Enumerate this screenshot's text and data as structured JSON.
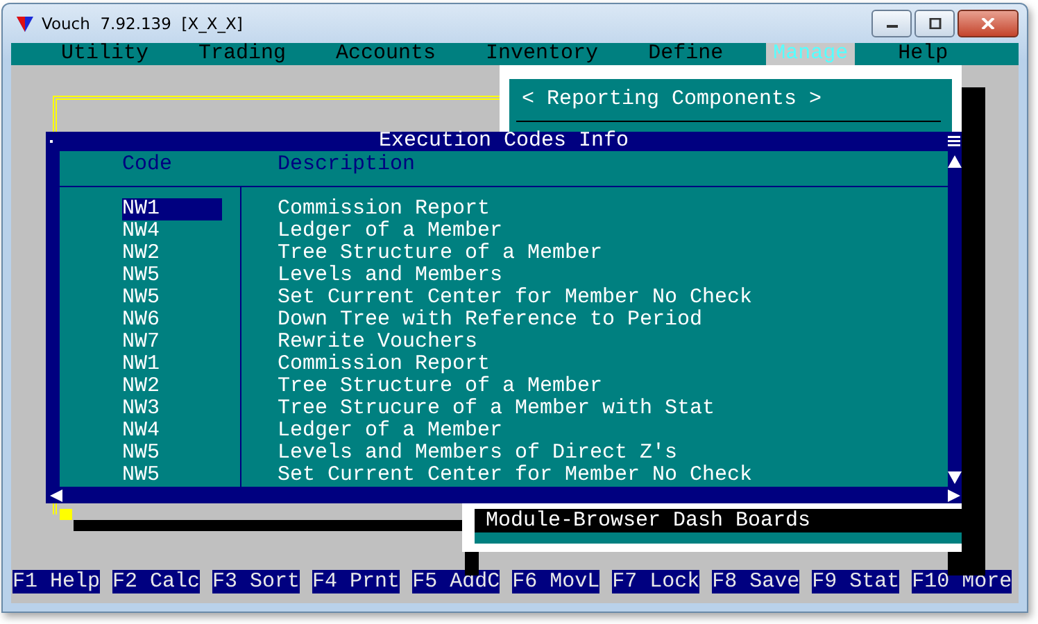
{
  "window": {
    "title": "Vouch  7.92.139  [X_X_X]"
  },
  "menu": [
    {
      "label": "Utility",
      "selected": false
    },
    {
      "label": "Trading",
      "selected": false
    },
    {
      "label": "Accounts",
      "selected": false
    },
    {
      "label": "Inventory",
      "selected": false
    },
    {
      "label": "Define",
      "selected": false
    },
    {
      "label": "Manage",
      "selected": true
    },
    {
      "label": "Help",
      "selected": false
    }
  ],
  "dropdown": {
    "items": [
      {
        "label": "< Reporting Components >",
        "selected": false
      },
      {
        "label": "Module-Browser Dash Boards",
        "selected": true
      }
    ]
  },
  "dialog": {
    "title": "Execution Codes Info",
    "columns": [
      "Code",
      "Description"
    ],
    "rows": [
      {
        "code": "NW1",
        "description": "Commission Report",
        "selected": true
      },
      {
        "code": "NW4",
        "description": "Ledger of a Member",
        "selected": false
      },
      {
        "code": "NW2",
        "description": "Tree Structure of a Member",
        "selected": false
      },
      {
        "code": "NW5",
        "description": "Levels and Members",
        "selected": false
      },
      {
        "code": "NW5",
        "description": "Set Current Center for Member No Check",
        "selected": false
      },
      {
        "code": "NW6",
        "description": "Down Tree with Reference to Period",
        "selected": false
      },
      {
        "code": "NW7",
        "description": "Rewrite Vouchers",
        "selected": false
      },
      {
        "code": "NW1",
        "description": "Commission Report",
        "selected": false
      },
      {
        "code": "NW2",
        "description": "Tree Structure of a Member",
        "selected": false
      },
      {
        "code": "NW3",
        "description": "Tree Strucure of a Member with Stat",
        "selected": false
      },
      {
        "code": "NW4",
        "description": "Ledger of a Member",
        "selected": false
      },
      {
        "code": "NW5",
        "description": "Levels and Members of Direct Z's",
        "selected": false
      },
      {
        "code": "NW5",
        "description": "Set Current Center for Member No Check",
        "selected": false
      }
    ]
  },
  "function_keys": [
    "F1 Help",
    "F2 Calc",
    "F3 Sort",
    "F4 Prnt",
    "F5 AddC",
    "F6 MovL",
    "F7 Lock",
    "F8 Save",
    "F9 Stat",
    "F10 More"
  ]
}
